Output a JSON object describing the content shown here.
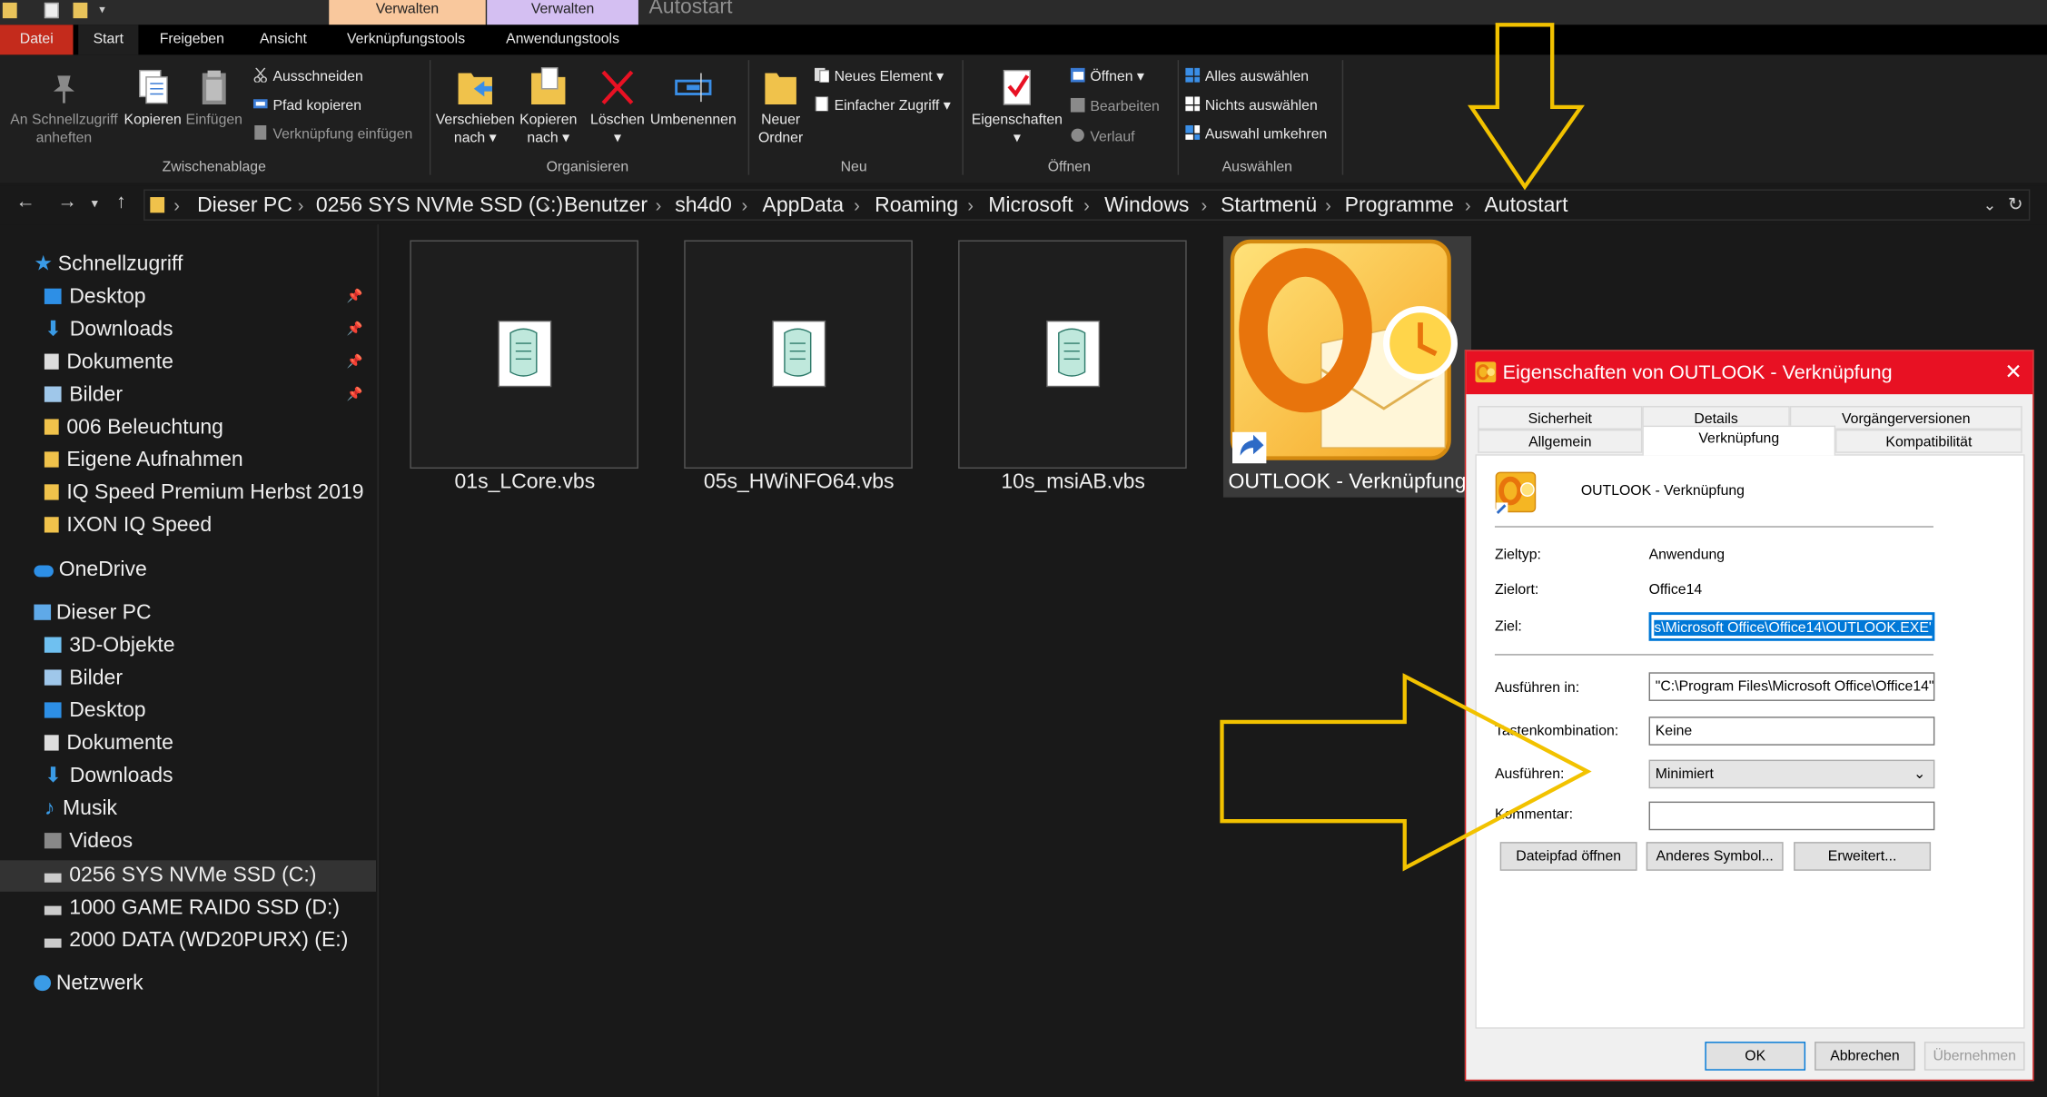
{
  "titlebar": {
    "context_tab_1": "Verwalten",
    "context_tab_2": "Verwalten",
    "window_title": "Autostart",
    "colors": {
      "ctx1": "#f9c89d",
      "ctx2": "#d4bff2"
    }
  },
  "ribbon_tabs": [
    "Datei",
    "Start",
    "Freigeben",
    "Ansicht",
    "Verknüpfungstools",
    "Anwendungstools"
  ],
  "ribbon": {
    "clipboard": {
      "pin_line1": "An Schnellzugriff",
      "pin_line2": "anheften",
      "copy": "Kopieren",
      "paste": "Einfügen",
      "cut": "Ausschneiden",
      "copy_path": "Pfad kopieren",
      "paste_shortcut": "Verknüpfung einfügen",
      "group": "Zwischenablage"
    },
    "organize": {
      "move_line1": "Verschieben",
      "move_line2": "nach",
      "copyto_line1": "Kopieren",
      "copyto_line2": "nach",
      "delete": "Löschen",
      "rename": "Umbenennen",
      "group": "Organisieren"
    },
    "new": {
      "folder_line1": "Neuer",
      "folder_line2": "Ordner",
      "new_item": "Neues Element",
      "easy_access": "Einfacher Zugriff",
      "group": "Neu"
    },
    "open": {
      "properties": "Eigenschaften",
      "open": "Öffnen",
      "edit": "Bearbeiten",
      "history": "Verlauf",
      "group": "Öffnen"
    },
    "select": {
      "select_all": "Alles auswählen",
      "select_none": "Nichts auswählen",
      "invert": "Auswahl umkehren",
      "group": "Auswählen"
    }
  },
  "address": {
    "crumbs": [
      "Dieser PC",
      "0256 SYS NVMe SSD (C:)",
      "Benutzer",
      "sh4d0",
      "AppData",
      "Roaming",
      "Microsoft",
      "Windows",
      "Startmenü",
      "Programme",
      "Autostart"
    ]
  },
  "nav": {
    "quick_access": "Schnellzugriff",
    "quick_items": [
      "Desktop",
      "Downloads",
      "Dokumente",
      "Bilder",
      "006 Beleuchtung",
      "Eigene Aufnahmen",
      "IQ Speed Premium Herbst 2019",
      "IXON IQ Speed"
    ],
    "onedrive": "OneDrive",
    "this_pc": "Dieser PC",
    "pc_items": [
      "3D-Objekte",
      "Bilder",
      "Desktop",
      "Dokumente",
      "Downloads",
      "Musik",
      "Videos",
      "0256 SYS NVMe SSD (C:)",
      "1000 GAME RAID0 SSD (D:)",
      "2000 DATA (WD20PURX) (E:)"
    ],
    "network": "Netzwerk"
  },
  "files": [
    "01s_LCore.vbs",
    "05s_HWiNFO64.vbs",
    "10s_msiAB.vbs",
    "OUTLOOK - Verknüpfung"
  ],
  "dialog": {
    "title": "Eigenschaften von OUTLOOK - Verknüpfung",
    "tabs_row1": [
      "Sicherheit",
      "Details",
      "Vorgängerversionen"
    ],
    "tabs_row2": [
      "Allgemein",
      "Verknüpfung",
      "Kompatibilität"
    ],
    "name": "OUTLOOK - Verknüpfung",
    "target_type_label": "Zieltyp:",
    "target_type": "Anwendung",
    "target_loc_label": "Zielort:",
    "target_loc": "Office14",
    "target_label": "Ziel:",
    "target": "s\\Microsoft Office\\Office14\\OUTLOOK.EXE\"",
    "start_in_label": "Ausführen in:",
    "start_in": "\"C:\\Program Files\\Microsoft Office\\Office14\"",
    "hotkey_label": "Tastenkombination:",
    "hotkey": "Keine",
    "run_label": "Ausführen:",
    "run": "Minimiert",
    "comment_label": "Kommentar:",
    "comment": "",
    "btn_open_path": "Dateipfad öffnen",
    "btn_change_icon": "Anderes Symbol...",
    "btn_advanced": "Erweitert...",
    "ok": "OK",
    "cancel": "Abbrechen",
    "apply": "Übernehmen"
  }
}
